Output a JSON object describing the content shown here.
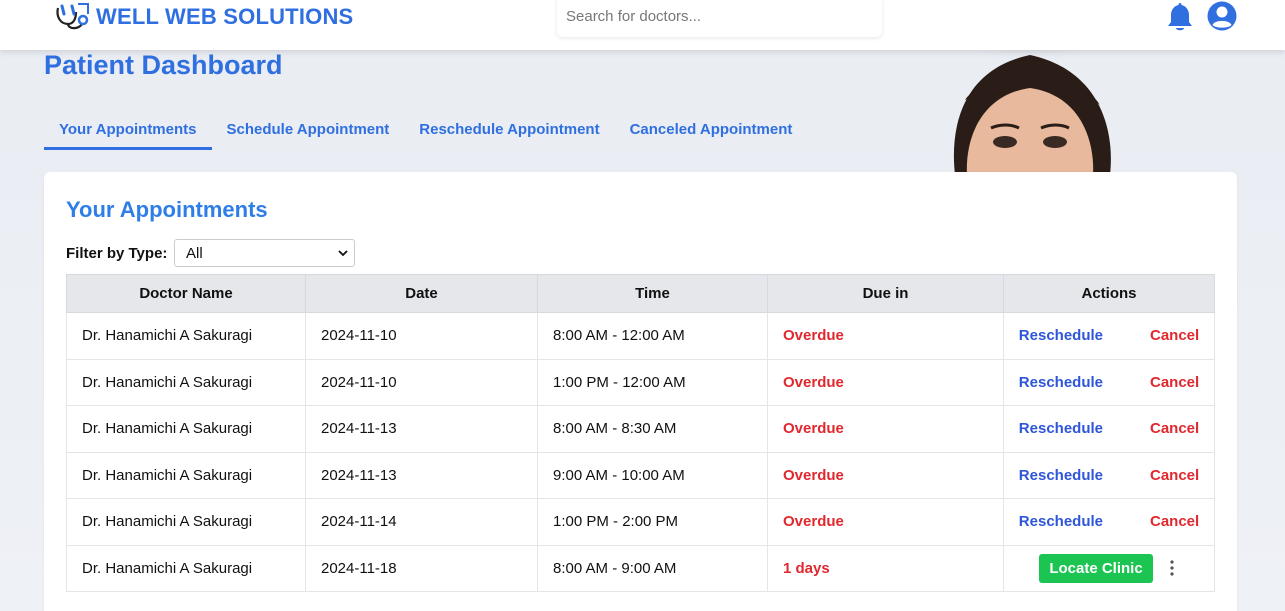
{
  "header": {
    "brand_name": "WELL WEB SOLUTIONS",
    "search_placeholder": "Search for doctors...",
    "icons": [
      "stethoscope-logo-icon",
      "bell-icon",
      "user-circle-icon"
    ]
  },
  "page": {
    "title": "Patient Dashboard",
    "tabs": [
      {
        "label": "Your Appointments",
        "active": true
      },
      {
        "label": "Schedule Appointment",
        "active": false
      },
      {
        "label": "Reschedule Appointment",
        "active": false
      },
      {
        "label": "Canceled Appointment",
        "active": false
      }
    ]
  },
  "appointments": {
    "title": "Your Appointments",
    "filter_label": "Filter by Type:",
    "filter_value": "All",
    "columns": [
      "Doctor Name",
      "Date",
      "Time",
      "Due in",
      "Actions"
    ],
    "rows": [
      {
        "doctor": "Dr. Hanamichi A Sakuragi",
        "date": "2024-11-10",
        "time": "8:00 AM - 12:00 AM",
        "due": "Overdue",
        "action1": "Reschedule",
        "action2": "Cancel"
      },
      {
        "doctor": "Dr. Hanamichi A Sakuragi",
        "date": "2024-11-10",
        "time": "1:00 PM - 12:00 AM",
        "due": "Overdue",
        "action1": "Reschedule",
        "action2": "Cancel"
      },
      {
        "doctor": "Dr. Hanamichi A Sakuragi",
        "date": "2024-11-13",
        "time": "8:00 AM - 8:30 AM",
        "due": "Overdue",
        "action1": "Reschedule",
        "action2": "Cancel"
      },
      {
        "doctor": "Dr. Hanamichi A Sakuragi",
        "date": "2024-11-13",
        "time": "9:00 AM - 10:00 AM",
        "due": "Overdue",
        "action1": "Reschedule",
        "action2": "Cancel"
      },
      {
        "doctor": "Dr. Hanamichi A Sakuragi",
        "date": "2024-11-14",
        "time": "1:00 PM - 2:00 PM",
        "due": "Overdue",
        "action1": "Reschedule",
        "action2": "Cancel"
      },
      {
        "doctor": "Dr. Hanamichi A Sakuragi",
        "date": "2024-11-18",
        "time": "8:00 AM - 9:00 AM",
        "due": "1 days",
        "action1": "Locate Clinic",
        "action2": ""
      }
    ]
  },
  "colors": {
    "brand_blue": "#2f6fe0",
    "overdue_red": "#e0282e",
    "locate_green": "#1cc552"
  }
}
